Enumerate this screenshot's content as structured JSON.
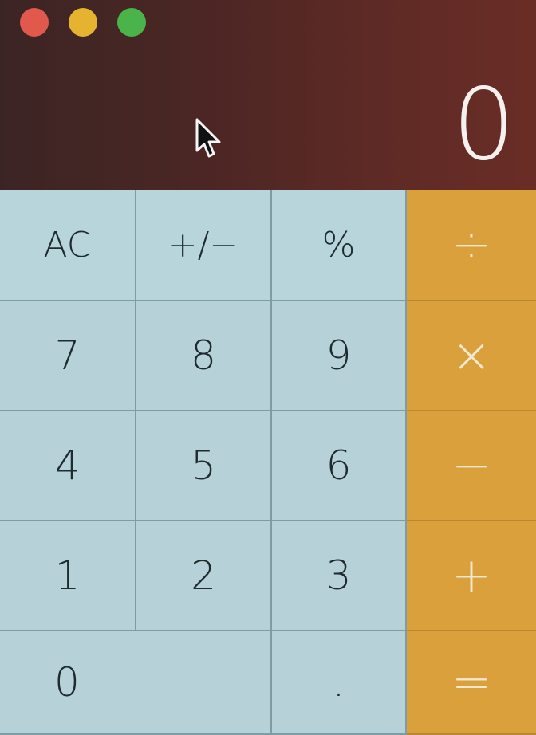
{
  "window": {
    "traffic_lights": {
      "close_color": "#e1584d",
      "minimize_color": "#e5b32f",
      "zoom_color": "#4ab34a"
    }
  },
  "display": {
    "value": "0"
  },
  "keys": {
    "ac": "AC",
    "sign": "+/−",
    "percent": "%",
    "divide": "÷",
    "seven": "7",
    "eight": "8",
    "nine": "9",
    "multiply": "×",
    "four": "4",
    "five": "5",
    "six": "6",
    "minus": "−",
    "one": "1",
    "two": "2",
    "three": "3",
    "plus": "+",
    "zero": "0",
    "decimal": ".",
    "equals": "="
  },
  "icons": {
    "cursor": "mouse-pointer-icon"
  }
}
